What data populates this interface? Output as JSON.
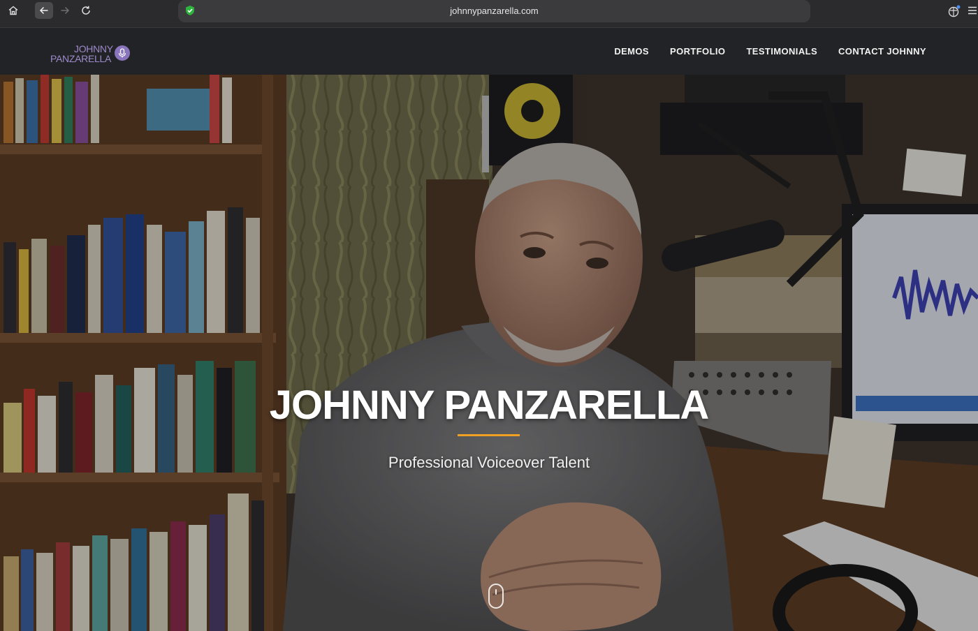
{
  "browser": {
    "url": "johnnypanzarella.com",
    "icons": [
      "home-icon",
      "back-arrow-icon",
      "forward-arrow-icon",
      "reload-icon",
      "shield-check-icon",
      "extension-icon",
      "menu-icon"
    ]
  },
  "site": {
    "logo": {
      "line1": "JOHNNY",
      "line2": "PANZARELLA",
      "icon": "microphone-icon",
      "color": "#9d8ac9"
    },
    "nav": [
      {
        "label": "DEMOS"
      },
      {
        "label": "PORTFOLIO"
      },
      {
        "label": "TESTIMONIALS"
      },
      {
        "label": "CONTACT JOHNNY"
      }
    ]
  },
  "hero": {
    "title": "JOHNNY PANZARELLA",
    "subtitle": "Professional Voiceover Talent",
    "accent_color": "#f0a022",
    "scroll_indicator": "mouse-scroll-icon"
  }
}
